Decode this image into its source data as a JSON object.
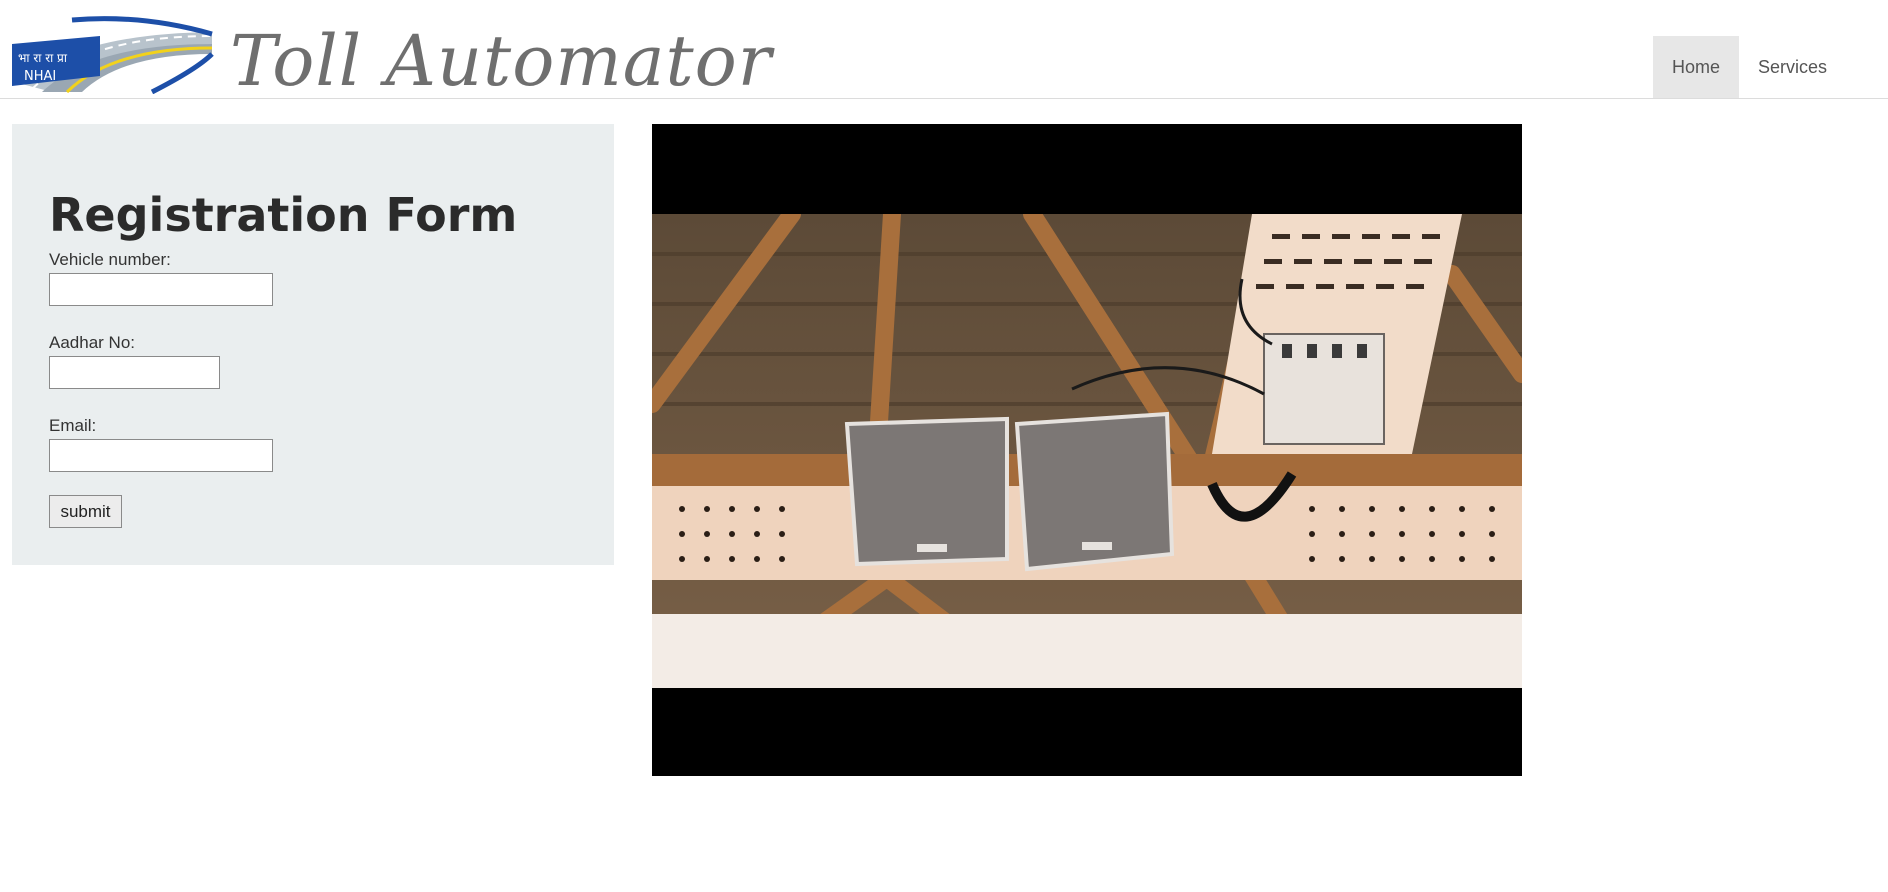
{
  "site": {
    "title": "Toll Automator",
    "logo_text_top": "भा रा रा प्रा",
    "logo_text_bottom": "NHAI"
  },
  "nav": {
    "items": [
      {
        "label": "Home",
        "active": true
      },
      {
        "label": "Services",
        "active": false
      }
    ]
  },
  "form": {
    "title": "Registration Form",
    "vehicle_label": "Vehicle number:",
    "vehicle_value": "",
    "aadhar_label": "Aadhar No:",
    "aadhar_value": "",
    "email_label": "Email:",
    "email_value": "",
    "submit_label": "submit"
  },
  "colors": {
    "panel_bg": "#eaeeef",
    "title_gray": "#6f6f6f",
    "nav_active_bg": "#e7e7e7",
    "logo_blue": "#1d4fa8",
    "logo_yellow": "#f2d21b"
  },
  "video": {
    "content": "video-player"
  }
}
